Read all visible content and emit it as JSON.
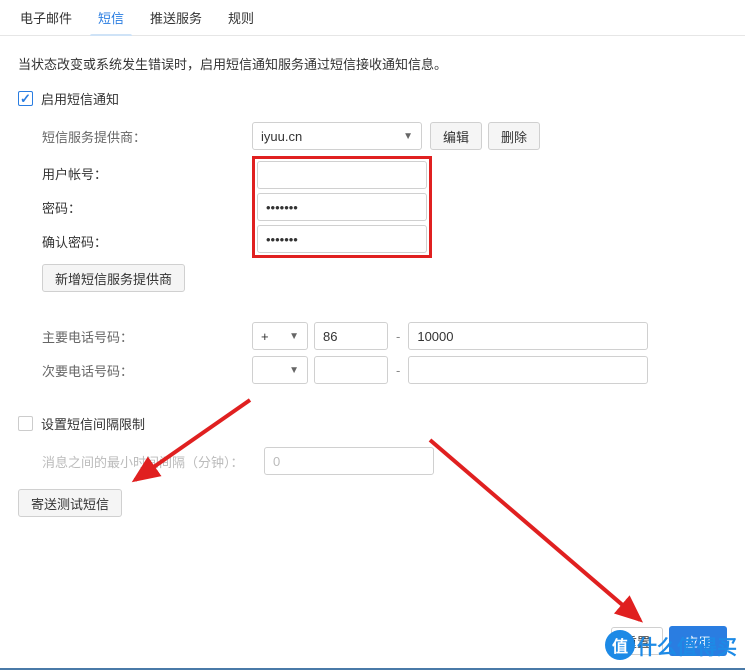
{
  "tabs": {
    "email": "电子邮件",
    "sms": "短信",
    "push": "推送服务",
    "rules": "规则"
  },
  "description": "当状态改变或系统发生错误时，启用短信通知服务通过短信接收通知信息。",
  "enable": {
    "label": "启用短信通知"
  },
  "provider": {
    "label": "短信服务提供商：",
    "selected": "iyuu.cn",
    "edit": "编辑",
    "delete": "删除"
  },
  "account": {
    "label": "用户帐号：",
    "value_masked": ""
  },
  "password": {
    "label": "密码：",
    "value_masked": "•••••••"
  },
  "confirm": {
    "label": "确认密码：",
    "value_masked": "•••••••"
  },
  "add_provider": "新增短信服务提供商",
  "primary_phone": {
    "label": "主要电话号码：",
    "prefix": "+",
    "cc": "86",
    "number": "10000"
  },
  "secondary_phone": {
    "label": "次要电话号码：",
    "prefix": "",
    "cc": "",
    "number": ""
  },
  "interval": {
    "label": "设置短信间隔限制",
    "desc": "消息之间的最小时间间隔（分钟）：",
    "value": "0"
  },
  "send_test": "寄送测试短信",
  "footer": {
    "reset": "重置",
    "apply": "应用"
  },
  "brand": {
    "first": "值",
    "rest": "什么值得买"
  }
}
